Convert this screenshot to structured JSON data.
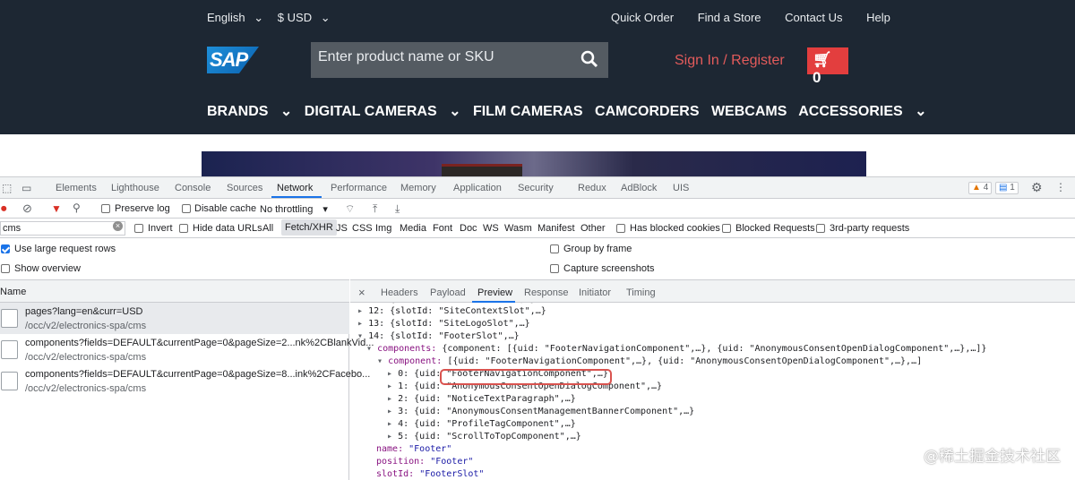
{
  "site": {
    "language": "English",
    "currency": "$ USD",
    "top_links": [
      "Quick Order",
      "Find a Store",
      "Contact Us",
      "Help"
    ],
    "logo_text": "SAP",
    "search_placeholder": "Enter product name or SKU",
    "signin": "Sign In / Register",
    "cart_count": "0",
    "nav": [
      "BRANDS",
      "DIGITAL CAMERAS",
      "FILM CAMERAS",
      "CAMCORDERS",
      "WEBCAMS",
      "ACCESSORIES"
    ],
    "header_bg": "#1d2733",
    "accent": "#e33e3e"
  },
  "devtools": {
    "tabs": [
      "Elements",
      "Lighthouse",
      "Console",
      "Sources",
      "Network",
      "Performance",
      "Memory",
      "Application",
      "Security",
      "Redux",
      "AdBlock",
      "UIS"
    ],
    "active_tab": "Network",
    "warnings": "4",
    "messages": "1",
    "toolbar": {
      "preserve_log": "Preserve log",
      "disable_cache": "Disable cache",
      "throttling": "No throttling"
    },
    "filter": {
      "value": "cms",
      "invert": "Invert",
      "hide_data_urls": "Hide data URLs",
      "types": [
        "All",
        "Fetch/XHR",
        "JS",
        "CSS",
        "Img",
        "Media",
        "Font",
        "Doc",
        "WS",
        "Wasm",
        "Manifest",
        "Other"
      ],
      "selected_type": "Fetch/XHR",
      "blocked_cookies": "Has blocked cookies",
      "blocked_requests": "Blocked Requests",
      "third_party": "3rd-party requests"
    },
    "settings": {
      "large_rows": "Use large request rows",
      "overview": "Show overview",
      "group_by_frame": "Group by frame",
      "screenshots": "Capture screenshots"
    },
    "name_header": "Name",
    "requests": [
      {
        "name": "pages?lang=en&curr=USD",
        "path": "/occ/v2/electronics-spa/cms"
      },
      {
        "name": "components?fields=DEFAULT&currentPage=0&pageSize=2...nk%2CBlankVid...",
        "path": "/occ/v2/electronics-spa/cms"
      },
      {
        "name": "components?fields=DEFAULT&currentPage=0&pageSize=8...ink%2CFacebo...",
        "path": "/occ/v2/electronics-spa/cms"
      }
    ],
    "detail_tabs": [
      "Headers",
      "Payload",
      "Preview",
      "Response",
      "Initiator",
      "Timing"
    ],
    "active_detail_tab": "Preview",
    "preview": {
      "l0": "12: {slotId: \"SiteContextSlot\",…}",
      "l1": "13: {slotId: \"SiteLogoSlot\",…}",
      "l2": "14: {slotId: \"FooterSlot\",…}",
      "l3_key": "components:",
      "l3_val": "{component: [{uid: \"FooterNavigationComponent\",…}, {uid: \"AnonymousConsentOpenDialogComponent\",…},…]}",
      "l4_key": "component:",
      "l4_val": "[{uid: \"FooterNavigationComponent\",…}, {uid: \"AnonymousConsentOpenDialogComponent\",…},…]",
      "items": [
        "0: {uid: \"FooterNavigationComponent\",…}",
        "1: {uid: \"AnonymousConsentOpenDialogComponent\",…}",
        "2: {uid: \"NoticeTextParagraph\",…}",
        "3: {uid: \"AnonymousConsentManagementBannerComponent\",…}",
        "4: {uid: \"ProfileTagComponent\",…}",
        "5: {uid: \"ScrollToTopComponent\",…}"
      ],
      "name_key": "name:",
      "name_val": "\"Footer\"",
      "position_key": "position:",
      "position_val": "\"Footer\"",
      "slot_key": "slotId:",
      "slot_val": "\"FooterSlot\""
    }
  },
  "watermark": "@稀土掘金技术社区"
}
